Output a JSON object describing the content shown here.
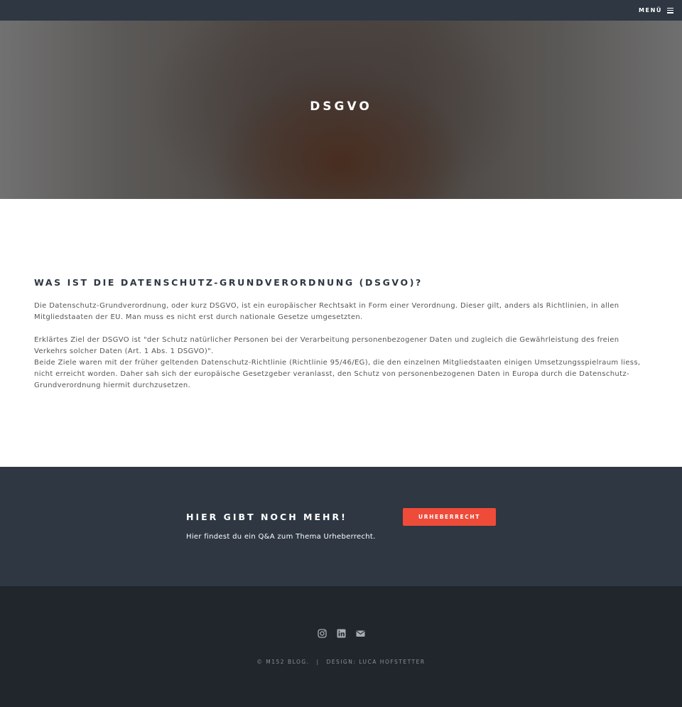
{
  "nav": {
    "menu_label": "MENÜ",
    "menu_icon": "hamburger-icon"
  },
  "hero": {
    "title": "DSGVO"
  },
  "article": {
    "title": "WAS IST DIE DATENSCHUTZ-GRUNDVERORDNUNG (DSGVO)?",
    "paragraph1": "Die Datenschutz-Grundverordnung, oder kurz DSGVO, ist ein europäischer Rechtsakt in Form einer Verordnung. Dieser gilt, anders als Richtlinien, in allen Mitgliedstaaten der EU. Man muss es nicht erst durch nationale Gesetze umgesetzten.",
    "paragraph2": "Erklärtes Ziel der DSGVO ist \"der Schutz natürlicher Personen bei der Verarbeitung personenbezogener Daten und zugleich die Gewährleistung des freien Verkehrs solcher Daten (Art. 1 Abs. 1 DSGVO)\".",
    "paragraph3": "Beide Ziele waren mit der früher geltenden Datenschutz-Richtlinie (Richtlinie 95/46/EG), die den einzelnen Mitgliedstaaten einigen Umsetzungsspielraum liess, nicht erreicht worden. Daher sah sich der europäische Gesetzgeber veranlasst, den Schutz von personenbezogenen Daten in Europa durch die Datenschutz-Grundverordnung hiermit durchzusetzen."
  },
  "cta": {
    "title": "HIER GIBT NOCH MEHR!",
    "subtitle": "Hier findest du ein Q&A zum Thema Urheberrecht.",
    "button_label": "URHEBERRECHT",
    "button_color": "#ee4b39"
  },
  "footer": {
    "social_icons": [
      "instagram-icon",
      "linkedin-icon",
      "envelope-icon"
    ],
    "copyright": "© M152 BLOG.",
    "separator": "|",
    "design_credit": "DESIGN: LUCA HOFSTETTER"
  },
  "colors": {
    "navbar": "#2e3742",
    "cta_background": "#2e3742",
    "footer_background": "#21252c",
    "accent": "#ee4b39"
  }
}
